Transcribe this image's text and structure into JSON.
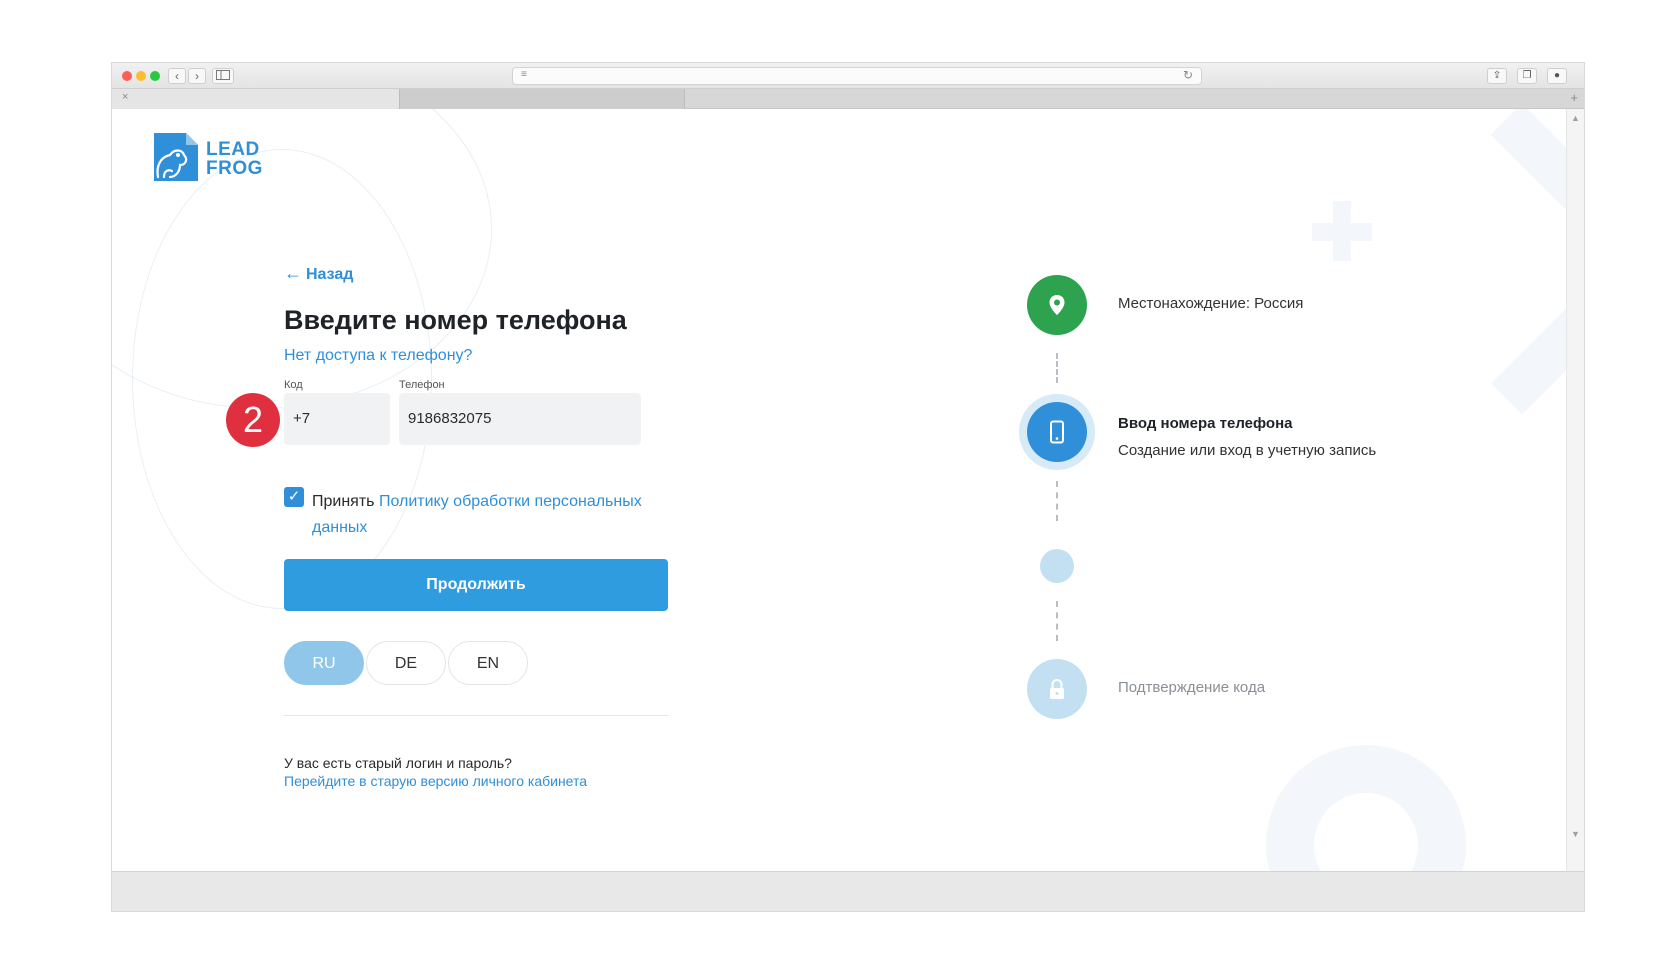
{
  "browser": {
    "tab_close": "×",
    "tab_new": "+",
    "nav_back": "‹",
    "nav_forward": "›"
  },
  "logo": {
    "line1": "LEAD",
    "line2": "FROG"
  },
  "form": {
    "back_arrow": "←",
    "back_label": "Назад",
    "title": "Введите номер телефона",
    "no_access_link": "Нет доступа к телефону?",
    "code_label": "Код",
    "code_value": "+7",
    "phone_label": "Телефон",
    "phone_value": "9186832075",
    "step_badge": "2",
    "checkbox_checked": true,
    "checkbox_mark": "✓",
    "consent_prefix": "Принять",
    "consent_link": "Политику обработки персональных данных",
    "continue_button": "Продолжить",
    "languages": [
      "RU",
      "DE",
      "EN"
    ],
    "active_language": "RU",
    "old_login_question": "У вас есть старый логин и пароль?",
    "old_login_link": "Перейдите в старую версию личного кабинета"
  },
  "steps": [
    {
      "title": "Местонахождение: Россия",
      "subtitle": "",
      "state": "done",
      "icon": "location-pin-icon"
    },
    {
      "title": "Ввод номера телефона",
      "subtitle": "Создание или вход в учетную запись",
      "state": "current",
      "icon": "phone-icon"
    },
    {
      "title": "",
      "subtitle": "",
      "state": "pending",
      "icon": ""
    },
    {
      "title": "Подтверждение кода",
      "subtitle": "",
      "state": "pending",
      "icon": "lock-icon"
    }
  ],
  "colors": {
    "brand_blue": "#2f8fd8",
    "button_blue": "#2f9ce0",
    "step_green": "#2ea34f",
    "step_pending": "#c3e0f2",
    "badge_red": "#e0303f"
  }
}
